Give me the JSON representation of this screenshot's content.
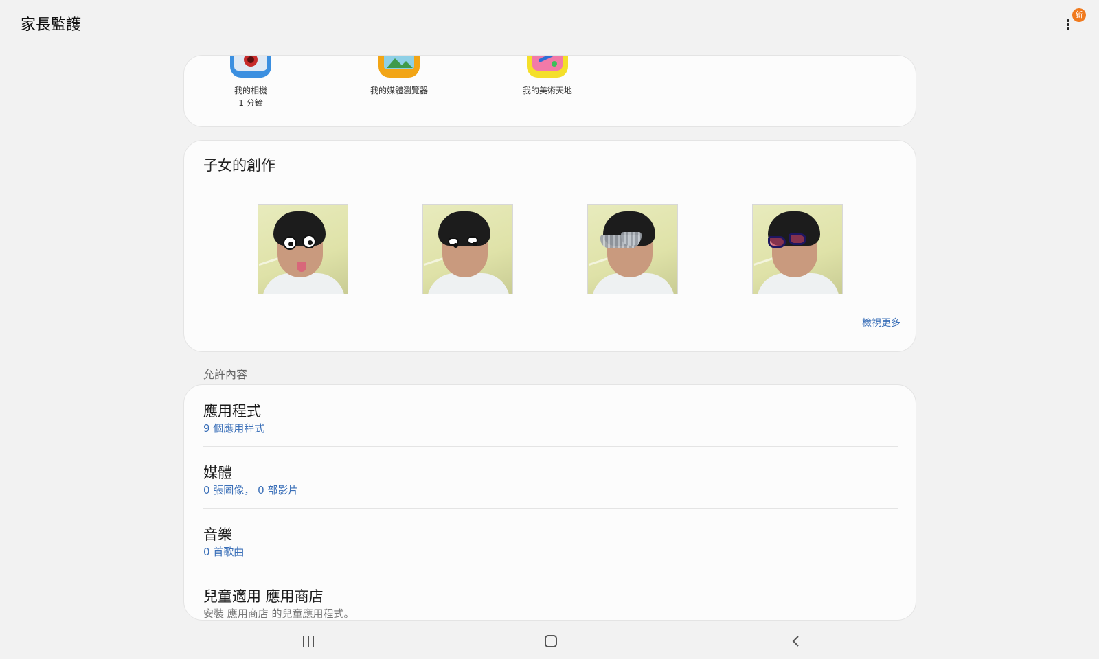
{
  "appbar": {
    "title": "家長監護",
    "new_badge": "新",
    "more_icon": "more-vert-icon"
  },
  "apps": [
    {
      "name": "我的相機",
      "time": "1 分鐘",
      "icon": "camera-app-icon",
      "color": "#3b8fe0"
    },
    {
      "name": "我的媒體瀏覽器",
      "time": "",
      "icon": "media-browser-app-icon",
      "color": "#f2a516"
    },
    {
      "name": "我的美術天地",
      "time": "",
      "icon": "art-app-icon",
      "color": "#f4df2a"
    }
  ],
  "creations": {
    "title": "子女的創作",
    "see_more": "檢視更多",
    "items": [
      {
        "label": "creation-1",
        "filter": "googly-eyes"
      },
      {
        "label": "creation-2",
        "filter": "eyebrows"
      },
      {
        "label": "creation-3",
        "filter": "sunglasses"
      },
      {
        "label": "creation-4",
        "filter": "cat-eye-glasses"
      }
    ]
  },
  "allowed": {
    "header": "允許內容",
    "rows": [
      {
        "title": "應用程式",
        "sub": "9 個應用程式"
      },
      {
        "title": "媒體",
        "sub": "0 張圖像， 0 部影片"
      },
      {
        "title": "音樂",
        "sub": "0 首歌曲"
      },
      {
        "title": "兒童適用 應用商店",
        "sub": "安裝 應用商店 的兒童應用程式。"
      }
    ]
  },
  "navbar": {
    "recent_icon": "recent-apps-icon",
    "home_icon": "home-icon",
    "back_icon": "back-icon"
  }
}
